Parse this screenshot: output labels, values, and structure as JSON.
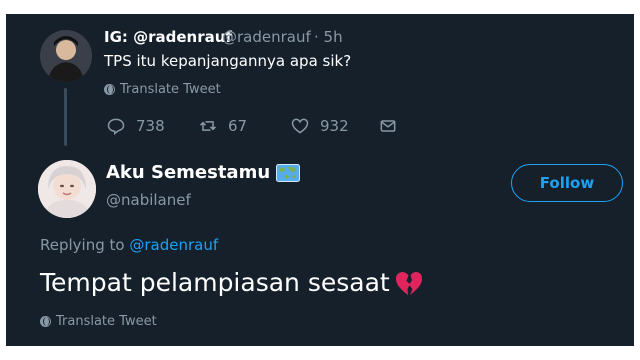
{
  "parent_tweet": {
    "display_name": "IG: @radenrauf",
    "handle": "@radenrauf",
    "time": "· 5h",
    "text": "TPS itu kepanjangannya apa sik?",
    "translate_label": "Translate Tweet",
    "actions": {
      "reply_count": "738",
      "retweet_count": "67",
      "like_count": "932"
    }
  },
  "reply_tweet": {
    "display_name": "Aku Semestamu",
    "handle": "@nabilanef",
    "follow_label": "Follow",
    "replying_to_prefix": "Replying to",
    "replying_to_handle": "@radenrauf",
    "text": "Tempat pelampiasan sesaat",
    "translate_label": "Translate Tweet"
  },
  "colors": {
    "background": "#15202b",
    "accent": "#1da1f2",
    "secondary_text": "#8899a6",
    "broken_heart": "#e0245e"
  }
}
